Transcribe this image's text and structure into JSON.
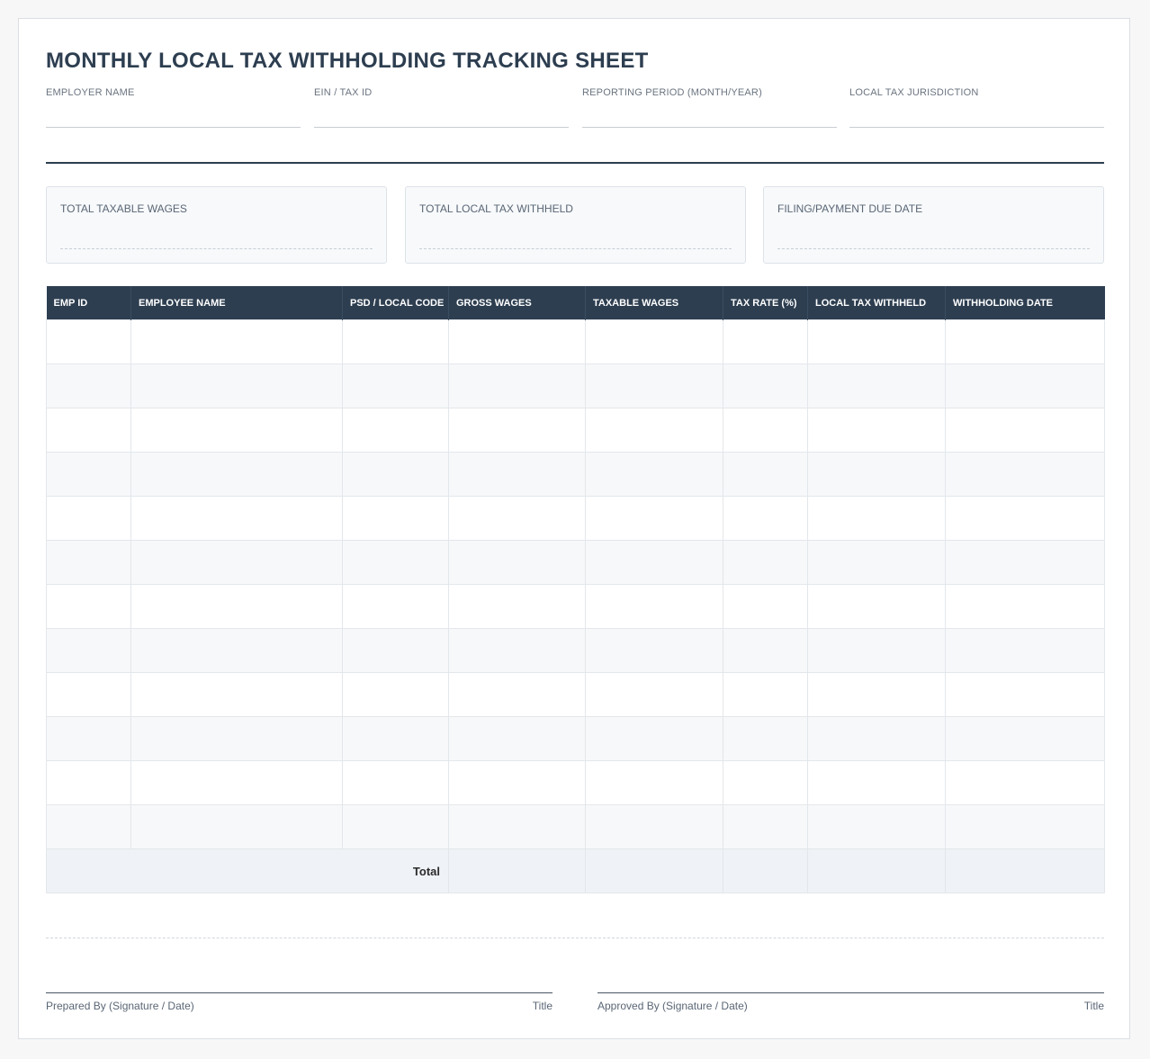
{
  "form": {
    "title": "MONTHLY LOCAL TAX WITHHOLDING TRACKING SHEET",
    "fields": [
      {
        "label": "EMPLOYER NAME",
        "value": ""
      },
      {
        "label": "EIN / TAX ID",
        "value": ""
      },
      {
        "label": "REPORTING PERIOD (MONTH/YEAR)",
        "value": ""
      },
      {
        "label": "LOCAL TAX JURISDICTION",
        "value": ""
      }
    ]
  },
  "summary": [
    {
      "label": "TOTAL TAXABLE WAGES",
      "value": ""
    },
    {
      "label": "TOTAL LOCAL TAX WITHHELD",
      "value": ""
    },
    {
      "label": "FILING/PAYMENT DUE DATE",
      "value": ""
    }
  ],
  "table": {
    "columns": [
      "EMP ID",
      "EMPLOYEE NAME",
      "PSD / LOCAL CODE",
      "GROSS WAGES",
      "TAXABLE WAGES",
      "TAX RATE (%)",
      "LOCAL TAX WITHHELD",
      "WITHHOLDING DATE"
    ],
    "rows": [
      [
        "",
        "",
        "",
        "",
        "",
        "",
        "",
        ""
      ],
      [
        "",
        "",
        "",
        "",
        "",
        "",
        "",
        ""
      ],
      [
        "",
        "",
        "",
        "",
        "",
        "",
        "",
        ""
      ],
      [
        "",
        "",
        "",
        "",
        "",
        "",
        "",
        ""
      ],
      [
        "",
        "",
        "",
        "",
        "",
        "",
        "",
        ""
      ],
      [
        "",
        "",
        "",
        "",
        "",
        "",
        "",
        ""
      ],
      [
        "",
        "",
        "",
        "",
        "",
        "",
        "",
        ""
      ],
      [
        "",
        "",
        "",
        "",
        "",
        "",
        "",
        ""
      ],
      [
        "",
        "",
        "",
        "",
        "",
        "",
        "",
        ""
      ],
      [
        "",
        "",
        "",
        "",
        "",
        "",
        "",
        ""
      ],
      [
        "",
        "",
        "",
        "",
        "",
        "",
        "",
        ""
      ],
      [
        "",
        "",
        "",
        "",
        "",
        "",
        "",
        ""
      ]
    ],
    "total_label": "Total",
    "totals": [
      "",
      "",
      "",
      "",
      ""
    ]
  },
  "signatures": [
    {
      "label": "Prepared By (Signature / Date)",
      "title": "Title"
    },
    {
      "label": "Approved By (Signature / Date)",
      "title": "Title"
    }
  ]
}
